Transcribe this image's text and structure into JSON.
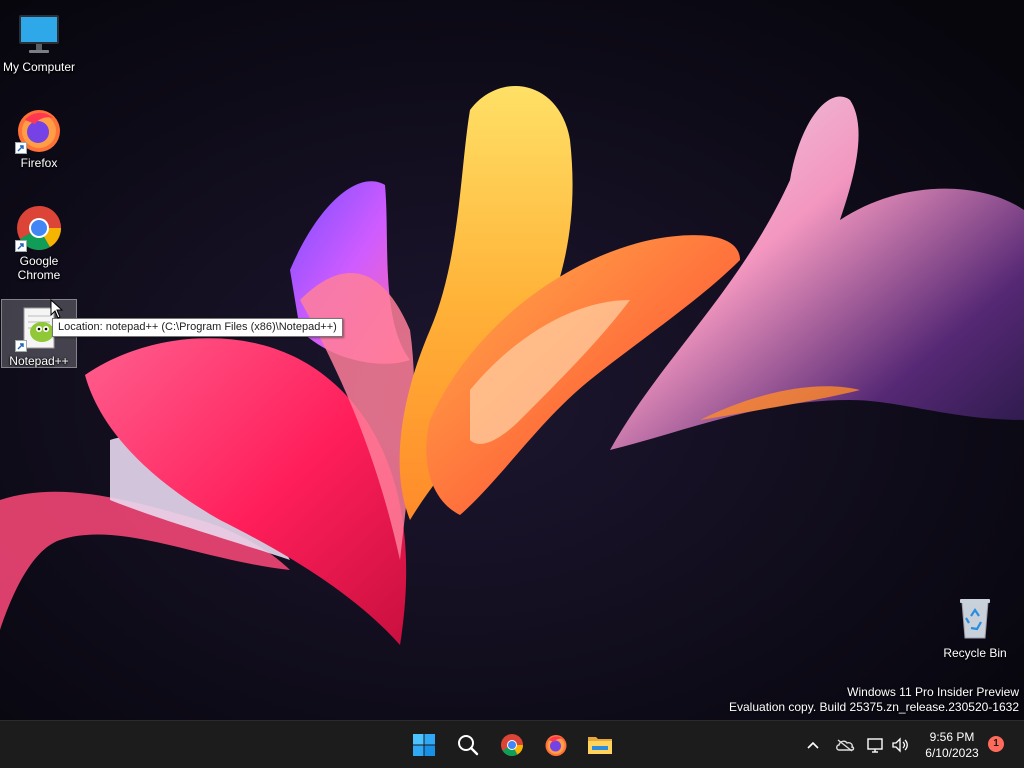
{
  "desktop_icons": [
    {
      "label": "My Computer",
      "icon": "monitor-icon"
    },
    {
      "label": "Firefox",
      "icon": "firefox-icon"
    },
    {
      "label": "Google Chrome",
      "icon": "chrome-icon"
    },
    {
      "label": "Notepad++",
      "icon": "notepadpp-icon"
    }
  ],
  "tooltip": {
    "text": "Location: notepad++ (C:\\Program Files (x86)\\Notepad++)"
  },
  "recycle_bin": {
    "label": "Recycle Bin",
    "icon": "recycle-bin-icon"
  },
  "watermark": {
    "line1": "Windows 11 Pro Insider Preview",
    "line2": "Evaluation copy. Build 25375.zn_release.230520-1632"
  },
  "taskbar": {
    "apps": [
      {
        "name": "Start",
        "icon": "windows-start-icon"
      },
      {
        "name": "Search",
        "icon": "search-icon"
      },
      {
        "name": "Google Chrome",
        "icon": "chrome-icon"
      },
      {
        "name": "Firefox",
        "icon": "firefox-icon"
      },
      {
        "name": "File Explorer",
        "icon": "folder-icon"
      }
    ],
    "tray_icons": [
      "chevron-up-icon",
      "onedrive-icon",
      "network-icon",
      "volume-icon"
    ],
    "clock": {
      "time": "9:56 PM",
      "date": "6/10/2023"
    },
    "notification_count": "1"
  },
  "colors": {
    "taskbar": "#1c1c1c",
    "accent": "#0078d4",
    "badge": "#ff6b5b"
  }
}
